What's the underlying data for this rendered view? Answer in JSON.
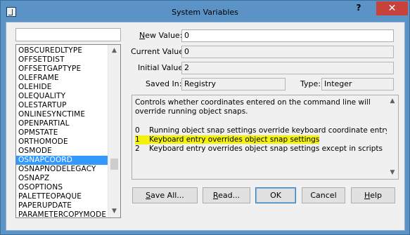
{
  "window": {
    "title": "System Variables",
    "help_label": "?",
    "close_label": "✕"
  },
  "variables": {
    "items": [
      "OBSCUREDLTYPE",
      "OFFSETDIST",
      "OFFSETGAPTYPE",
      "OLEFRAME",
      "OLEHIDE",
      "OLEQUALITY",
      "OLESTARTUP",
      "ONLINESYNCTIME",
      "OPENPARTIAL",
      "OPMSTATE",
      "ORTHOMODE",
      "OSMODE",
      "OSNAPCOORD",
      "OSNAPNODELEGACY",
      "OSNAPZ",
      "OSOPTIONS",
      "PALETTEOPAQUE",
      "PAPERUPDATE",
      "PARAMETERCOPYMODE"
    ],
    "selected": "OSNAPCOORD",
    "search_value": ""
  },
  "fields": {
    "new_value": {
      "label_first": "N",
      "label_rest": "ew Value:",
      "value": "0"
    },
    "current_value": {
      "label": "Current Value:",
      "value": "0"
    },
    "initial_value": {
      "label": "Initial Value:",
      "value": "2"
    },
    "saved_in": {
      "label": "Saved In:",
      "value": "Registry"
    },
    "type": {
      "label": "Type:",
      "value": "Integer"
    }
  },
  "description": {
    "text": "Controls whether coordinates entered on the command line will override running object snaps.",
    "options": [
      {
        "num": "0",
        "text": "Running object snap settings override keyboard coordinate entry",
        "highlighted": false
      },
      {
        "num": "1",
        "text": "Keyboard entry overrides object snap settings",
        "highlighted": true
      },
      {
        "num": "2",
        "text": "Keyboard entry overrides object snap settings except in scripts",
        "highlighted": false
      }
    ],
    "highlight_color": "#f4f20a"
  },
  "buttons": {
    "save_all": {
      "first": "S",
      "rest": "ave All..."
    },
    "read": {
      "first": "R",
      "rest": "ead..."
    },
    "ok": "OK",
    "cancel": "Cancel",
    "help": {
      "first": "H",
      "rest": "elp"
    }
  },
  "colors": {
    "selection": "#3399ff",
    "title_bar": "#5b93c6",
    "close_button": "#c7423a"
  }
}
